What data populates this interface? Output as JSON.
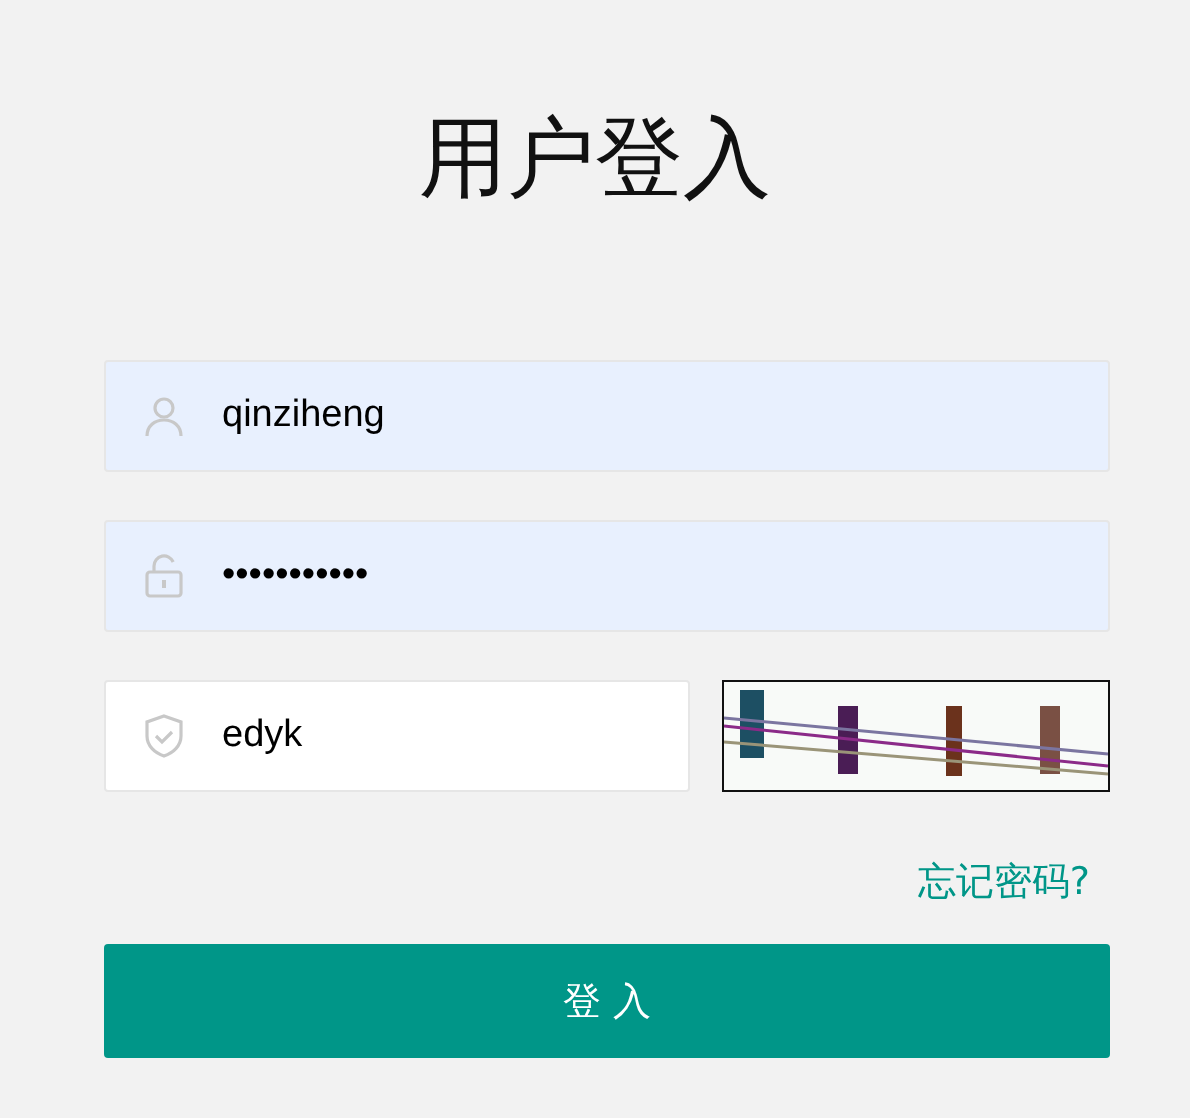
{
  "title": "用户登入",
  "fields": [
    {
      "kind": "user",
      "value": "qinziheng",
      "autofilled": true
    },
    {
      "kind": "password",
      "value": "•••••••••••",
      "autofilled": true
    },
    {
      "kind": "captcha",
      "value": "edyk",
      "autofilled": false
    }
  ],
  "forgot_link": "忘记密码?",
  "login_button": "登 入"
}
